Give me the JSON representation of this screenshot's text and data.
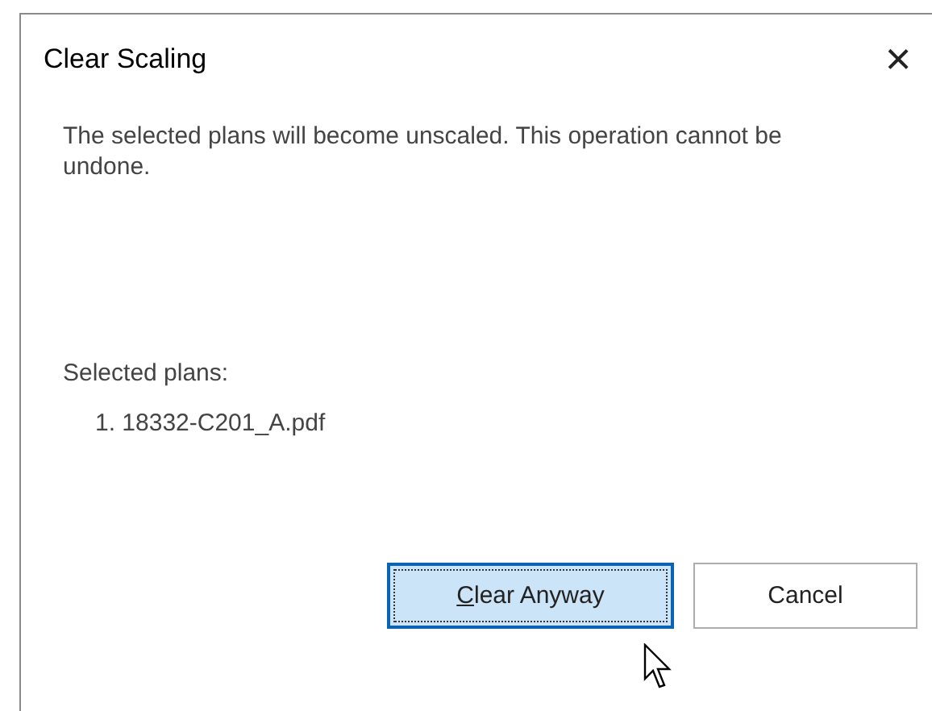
{
  "window": {
    "title": "Clear Scaling",
    "close_glyph": "×"
  },
  "message": "The selected plans will become unscaled. This operation cannot be undone.",
  "plans_label": "Selected plans:",
  "plans": [
    {
      "number": "1.",
      "name": "18332-C201_A.pdf"
    }
  ],
  "buttons": [
    {
      "label": "Clear Anyway",
      "default": true,
      "underline_first": true
    },
    {
      "label": "Cancel",
      "default": false,
      "underline_first": false
    }
  ]
}
